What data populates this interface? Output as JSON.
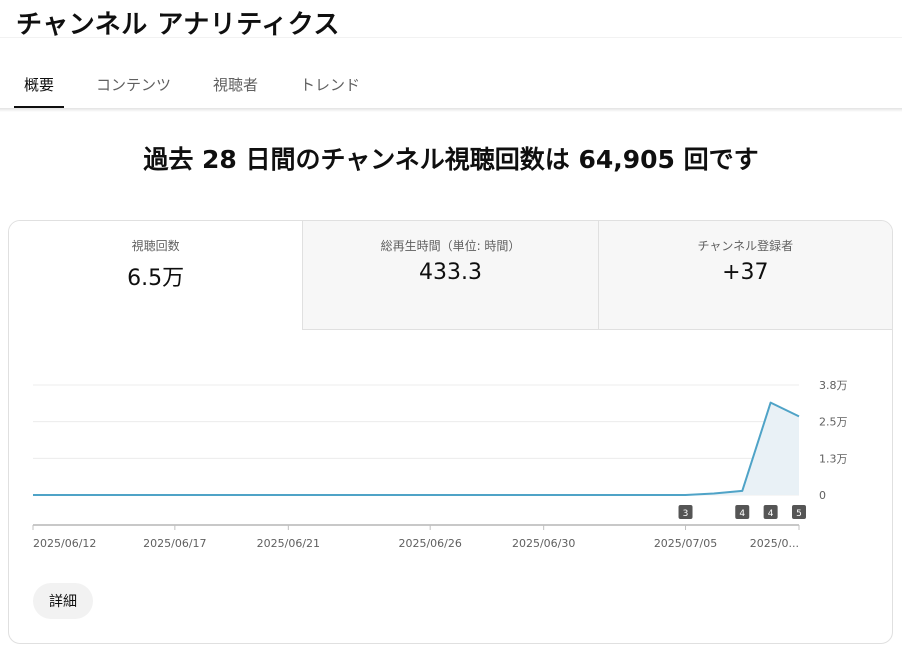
{
  "header": {
    "title": "チャンネル アナリティクス"
  },
  "tabs": [
    {
      "label": "概要",
      "active": true
    },
    {
      "label": "コンテンツ",
      "active": false
    },
    {
      "label": "視聴者",
      "active": false
    },
    {
      "label": "トレンド",
      "active": false
    }
  ],
  "headline": "過去 28 日間のチャンネル視聴回数は 64,905 回です",
  "metrics": [
    {
      "label": "視聴回数",
      "value": "6.5万"
    },
    {
      "label": "総再生時間（単位: 時間）",
      "value": "433.3"
    },
    {
      "label": "チャンネル登録者",
      "value": "+37"
    }
  ],
  "chart_data": {
    "type": "area",
    "x": [
      "2025/06/12",
      "2025/06/13",
      "2025/06/14",
      "2025/06/15",
      "2025/06/16",
      "2025/06/17",
      "2025/06/18",
      "2025/06/19",
      "2025/06/20",
      "2025/06/21",
      "2025/06/22",
      "2025/06/23",
      "2025/06/24",
      "2025/06/25",
      "2025/06/26",
      "2025/06/27",
      "2025/06/28",
      "2025/06/29",
      "2025/06/30",
      "2025/07/01",
      "2025/07/02",
      "2025/07/03",
      "2025/07/04",
      "2025/07/05",
      "2025/07/06",
      "2025/07/07",
      "2025/07/08",
      "2025/07/09"
    ],
    "series": [
      {
        "values": [
          0,
          0,
          0,
          0,
          0,
          0,
          0,
          0,
          0,
          0,
          0,
          0,
          0,
          0,
          0,
          0,
          0,
          0,
          0,
          0,
          0,
          0,
          0,
          0,
          500,
          1400,
          31500,
          26800
        ]
      }
    ],
    "x_tick_labels": [
      "2025/06/12",
      "2025/06/17",
      "2025/06/21",
      "2025/06/26",
      "2025/06/30",
      "2025/07/05",
      "2025/0..."
    ],
    "y_tick_labels": [
      "3.8万",
      "2.5万",
      "1.3万",
      "0"
    ],
    "y_ticks": [
      37500,
      25000,
      12500,
      0
    ],
    "ylim": [
      0,
      37500
    ],
    "markers": [
      {
        "date": "2025/07/05",
        "label": "3"
      },
      {
        "date": "2025/07/07",
        "label": "4"
      },
      {
        "date": "2025/07/08",
        "label": "4"
      },
      {
        "date": "2025/07/09",
        "label": "5"
      }
    ],
    "grid": true,
    "line_color": "#4fa3c7",
    "fill_color": "#e9f1f6"
  },
  "details_button": {
    "label": "詳細"
  }
}
